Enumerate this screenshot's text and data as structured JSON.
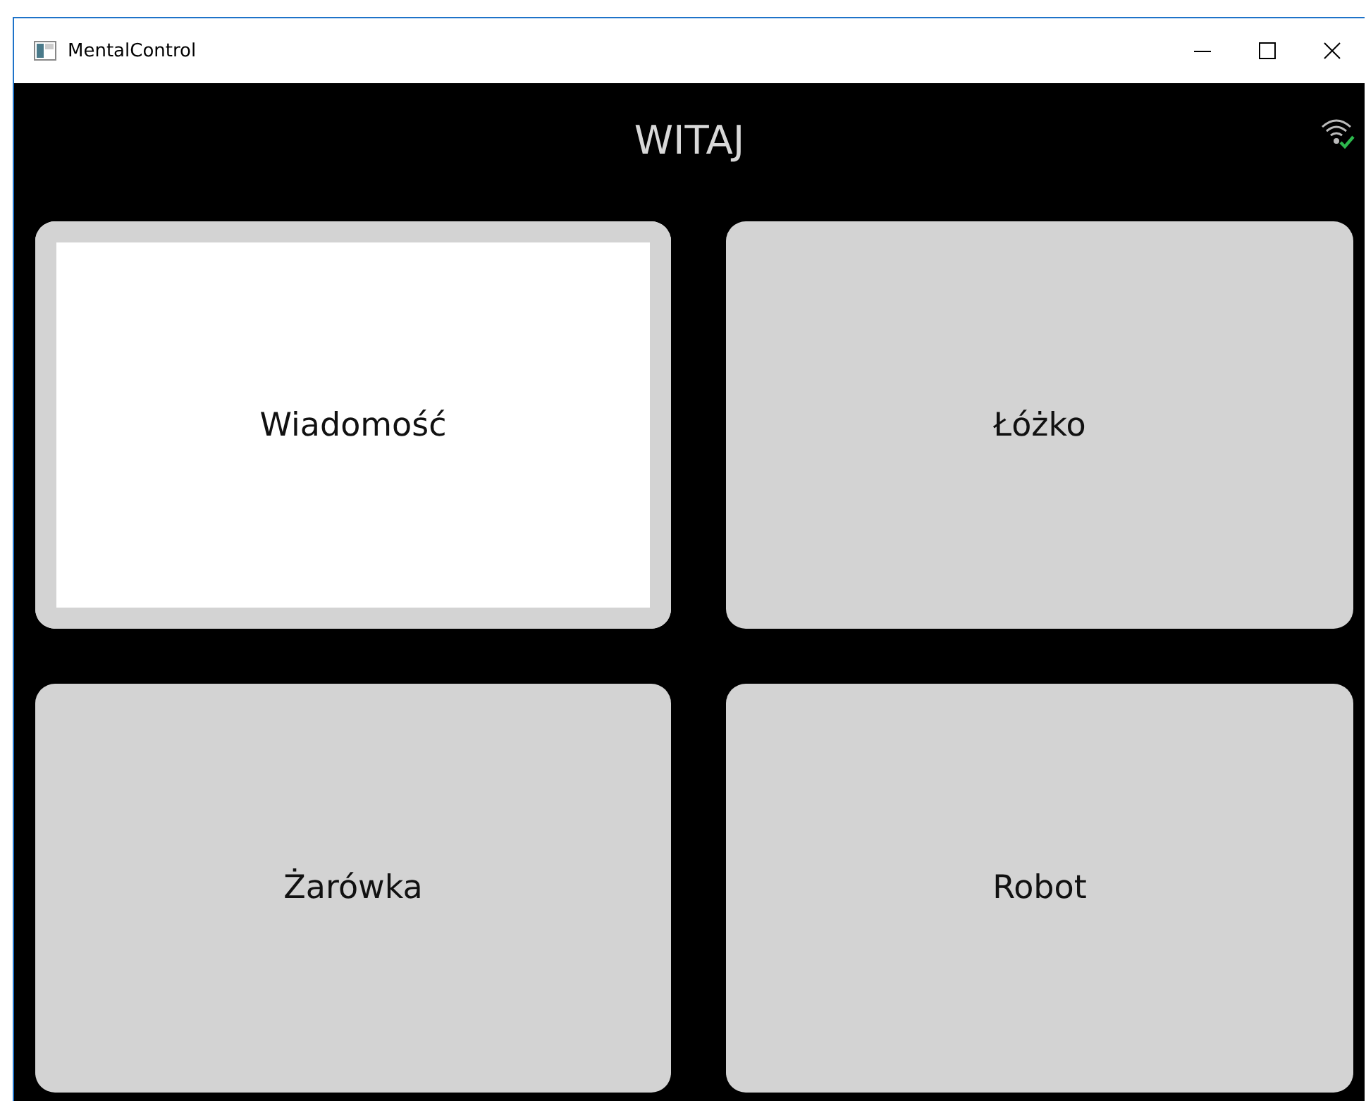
{
  "window": {
    "title": "MentalControl"
  },
  "header": {
    "title": "WITAJ",
    "connected": true
  },
  "tiles": [
    {
      "label": "Wiadomość",
      "selected": true
    },
    {
      "label": "Łóżko",
      "selected": false
    },
    {
      "label": "Żarówka",
      "selected": false
    },
    {
      "label": "Robot",
      "selected": false
    }
  ]
}
